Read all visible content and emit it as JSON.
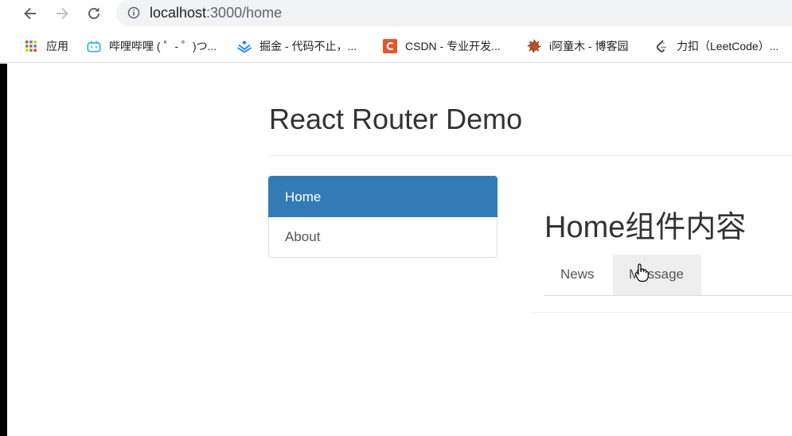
{
  "browser": {
    "url_host": "localhost",
    "url_rest": ":3000/home"
  },
  "bookmarks": [
    {
      "label": "应用",
      "icon": "apps-grid-icon"
    },
    {
      "label": "哔哩哔哩 ( ゜- ゜)つ...",
      "icon": "bilibili-icon"
    },
    {
      "label": "掘金 - 代码不止，...",
      "icon": "juejin-icon"
    },
    {
      "label": "CSDN - 专业开发...",
      "icon": "csdn-icon"
    },
    {
      "label": "i阿童木 - 博客园",
      "icon": "cnblogs-icon"
    },
    {
      "label": "力扣（LeetCode）...",
      "icon": "leetcode-icon"
    }
  ],
  "page": {
    "title": "React Router Demo",
    "nav": [
      {
        "label": "Home",
        "active": true
      },
      {
        "label": "About",
        "active": false
      }
    ],
    "content_heading": "Home组件内容",
    "tabs": [
      {
        "label": "News"
      },
      {
        "label": "Message"
      }
    ]
  },
  "colors": {
    "active": "#337ab7",
    "tab_hover": "#eeeeee",
    "omnibox": "#f1f3f4"
  }
}
